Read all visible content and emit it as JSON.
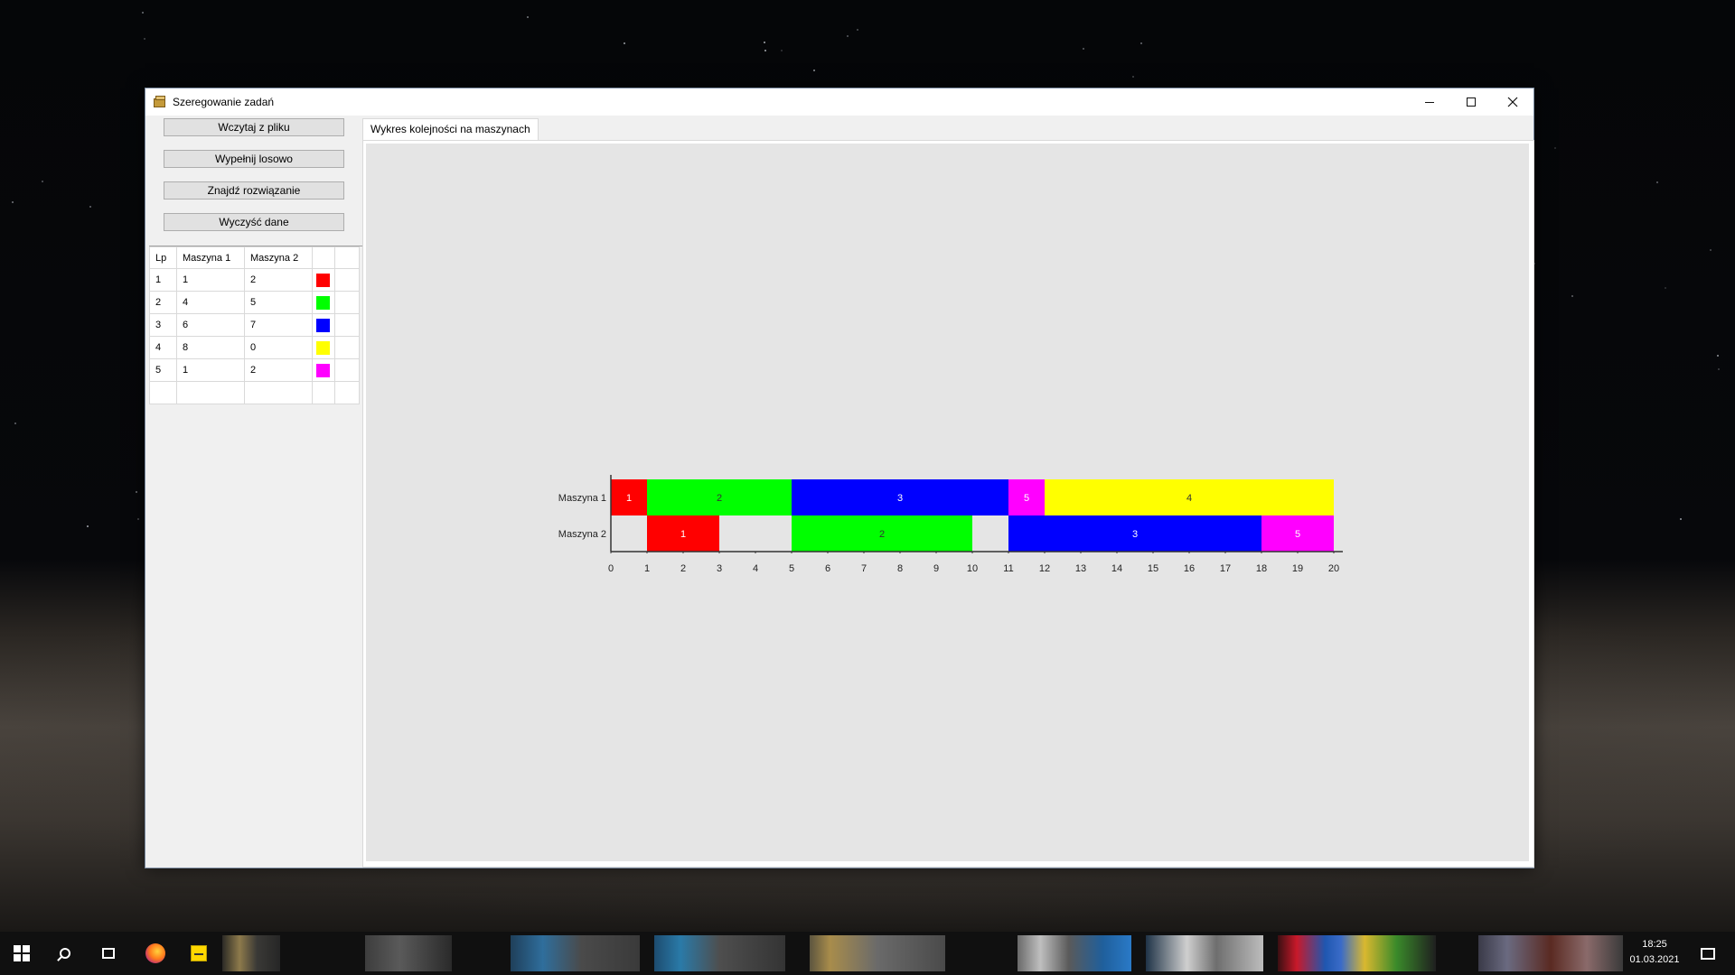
{
  "window": {
    "title": "Szeregowanie zadań",
    "caption_icons": [
      "minimize-icon",
      "maximize-icon",
      "close-icon"
    ]
  },
  "buttons": {
    "load": "Wczytaj z pliku",
    "random": "Wypełnij losowo",
    "solve": "Znajdź rozwiązanie",
    "clear": "Wyczyść dane"
  },
  "grid": {
    "headers": [
      "Lp",
      "Maszyna 1",
      "Maszyna 2"
    ],
    "rows": [
      {
        "lp": "1",
        "m1": "1",
        "m2": "2",
        "color": "#ff0000"
      },
      {
        "lp": "2",
        "m1": "4",
        "m2": "5",
        "color": "#00ff00"
      },
      {
        "lp": "3",
        "m1": "6",
        "m2": "7",
        "color": "#0000ff"
      },
      {
        "lp": "4",
        "m1": "8",
        "m2": "0",
        "color": "#ffff00"
      },
      {
        "lp": "5",
        "m1": "1",
        "m2": "2",
        "color": "#ff00ff"
      }
    ]
  },
  "tabs": {
    "chart": "Wykres kolejności na maszynach"
  },
  "chart_data": {
    "type": "gantt",
    "machines": [
      "Maszyna 1",
      "Maszyna 2"
    ],
    "x_ticks": [
      0,
      1,
      2,
      3,
      4,
      5,
      6,
      7,
      8,
      9,
      10,
      11,
      12,
      13,
      14,
      15,
      16,
      17,
      18,
      19,
      20
    ],
    "xlim": [
      0,
      20
    ],
    "tasks": [
      {
        "machine": "Maszyna 1",
        "job": "1",
        "start": 0,
        "end": 1,
        "color": "#ff0000",
        "label_color": "#ffffff"
      },
      {
        "machine": "Maszyna 1",
        "job": "2",
        "start": 1,
        "end": 5,
        "color": "#00ff00",
        "label_color": "#333333"
      },
      {
        "machine": "Maszyna 1",
        "job": "3",
        "start": 5,
        "end": 11,
        "color": "#0000ff",
        "label_color": "#ffffff"
      },
      {
        "machine": "Maszyna 1",
        "job": "5",
        "start": 11,
        "end": 12,
        "color": "#ff00ff",
        "label_color": "#ffffff"
      },
      {
        "machine": "Maszyna 1",
        "job": "4",
        "start": 12,
        "end": 20,
        "color": "#ffff00",
        "label_color": "#333333"
      },
      {
        "machine": "Maszyna 2",
        "job": "1",
        "start": 1,
        "end": 3,
        "color": "#ff0000",
        "label_color": "#ffffff"
      },
      {
        "machine": "Maszyna 2",
        "job": "2",
        "start": 5,
        "end": 10,
        "color": "#00ff00",
        "label_color": "#333333"
      },
      {
        "machine": "Maszyna 2",
        "job": "3",
        "start": 11,
        "end": 18,
        "color": "#0000ff",
        "label_color": "#ffffff"
      },
      {
        "machine": "Maszyna 2",
        "job": "5",
        "start": 18,
        "end": 20,
        "color": "#ff00ff",
        "label_color": "#ffffff"
      }
    ]
  },
  "taskbar": {
    "time": "18:25",
    "date": "01.03.2021",
    "icons": [
      "windows-start-icon",
      "search-icon",
      "task-view-icon",
      "firefox-icon",
      "sticky-notes-icon",
      "notification-icon"
    ]
  }
}
